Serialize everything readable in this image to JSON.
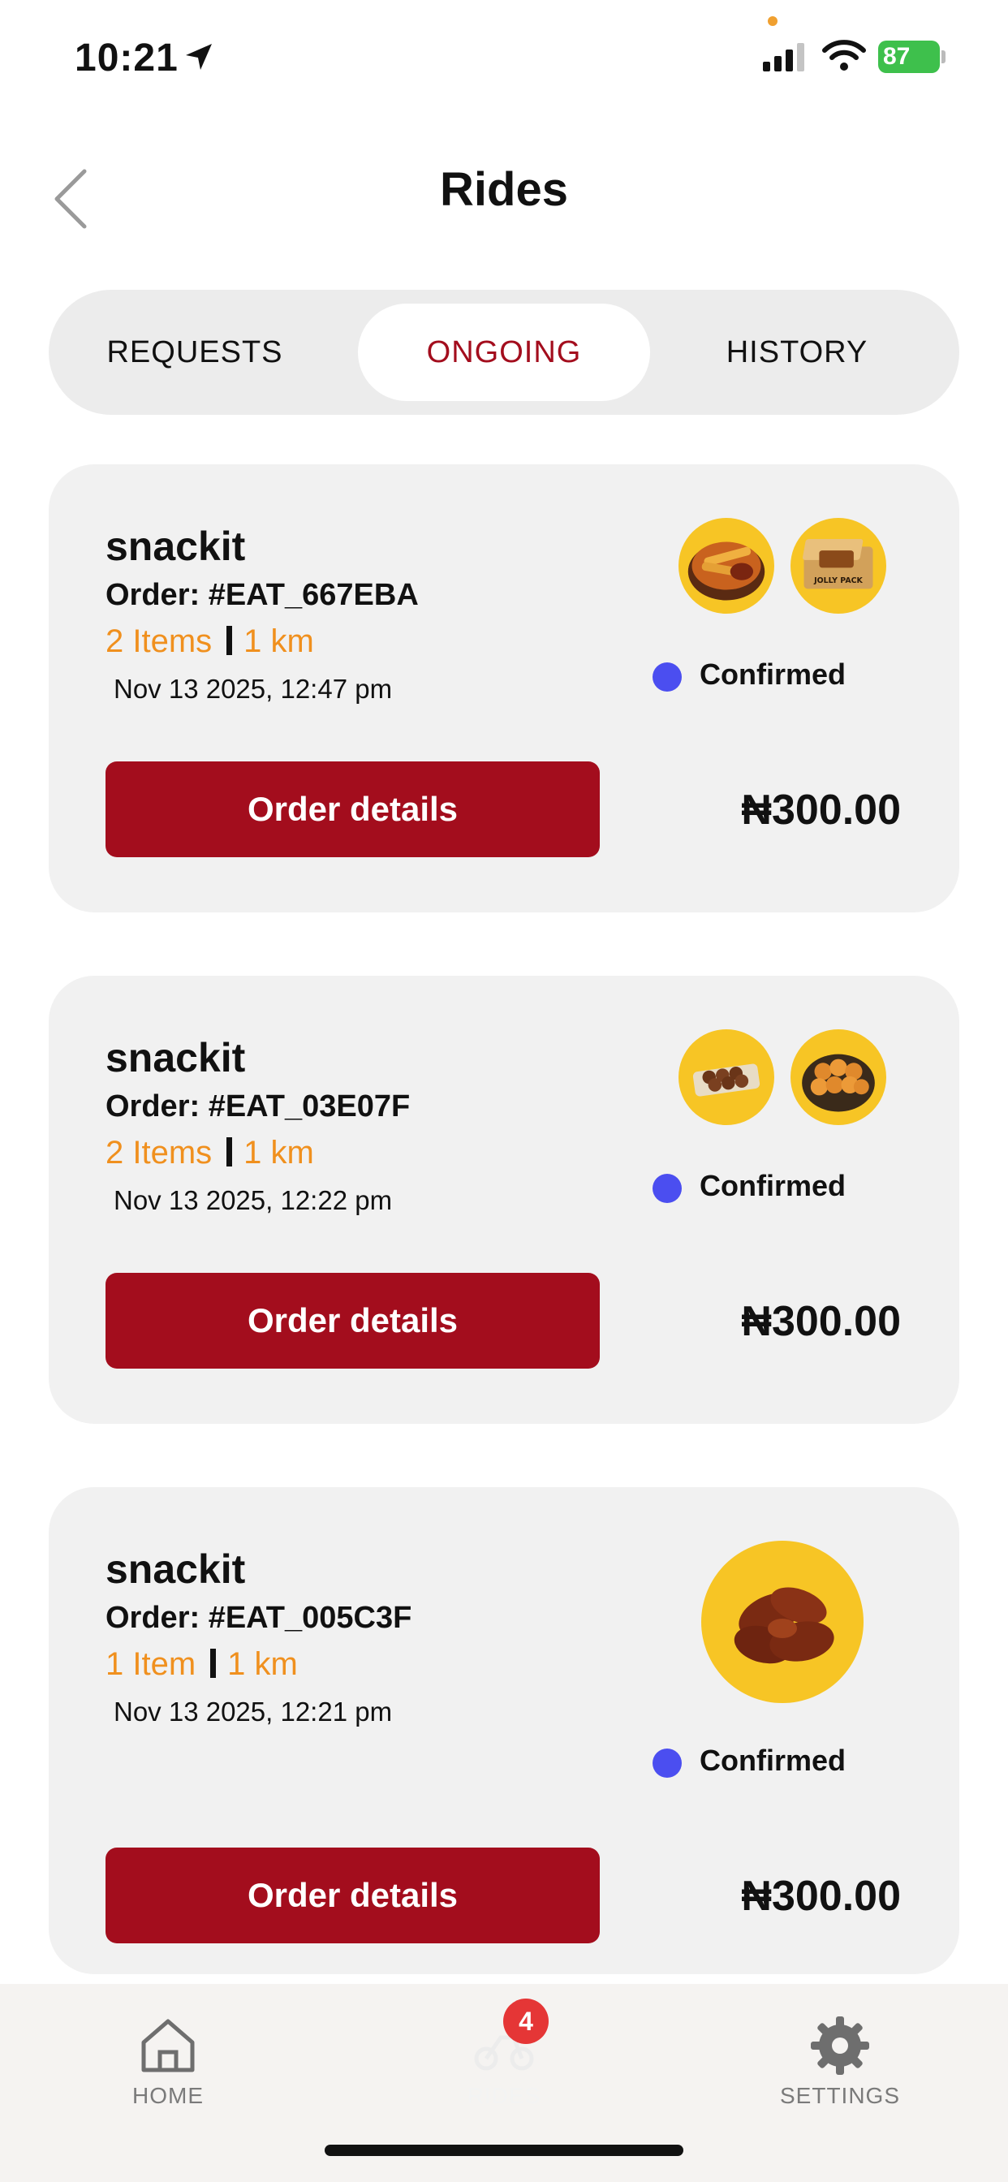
{
  "status_bar": {
    "time": "10:21",
    "battery": "87",
    "icons": [
      "location-arrow-icon",
      "signal-icon",
      "wifi-icon",
      "battery-icon"
    ]
  },
  "header": {
    "title": "Rides",
    "back_icon": "chevron-left-icon"
  },
  "tabs": [
    {
      "label": "REQUESTS",
      "active": false
    },
    {
      "label": "ONGOING",
      "active": true
    },
    {
      "label": "HISTORY",
      "active": false
    }
  ],
  "orders": [
    {
      "vendor": "snackit",
      "order": "Order: #EAT_667EBA",
      "items": "2 Items",
      "distance": "1 km",
      "date": "Nov 13 2025, 12:47 pm",
      "status": "Confirmed",
      "button": "Order details",
      "price": "₦300.00",
      "thumb_labels": [
        "JOLLY PACK"
      ]
    },
    {
      "vendor": "snackit",
      "order": "Order: #EAT_03E07F",
      "items": "2 Items",
      "distance": "1 km",
      "date": "Nov 13 2025, 12:22 pm",
      "status": "Confirmed",
      "button": "Order details",
      "price": "₦300.00"
    },
    {
      "vendor": "snackit",
      "order": "Order: #EAT_005C3F",
      "items": "1 Item",
      "distance": "1 km",
      "date": "Nov 13 2025, 12:21 pm",
      "status": "Confirmed",
      "button": "Order details",
      "price": "₦300.00"
    }
  ],
  "bottom_nav": {
    "home": "HOME",
    "rides": "RIDES",
    "settings": "SETTINGS",
    "rides_badge": "4"
  },
  "colors": {
    "accent": "#a30d1d",
    "meta_orange": "#f0901e",
    "status_dot": "#4b4ef0",
    "card_bg": "#f1f1f1",
    "badge": "#e53636"
  }
}
